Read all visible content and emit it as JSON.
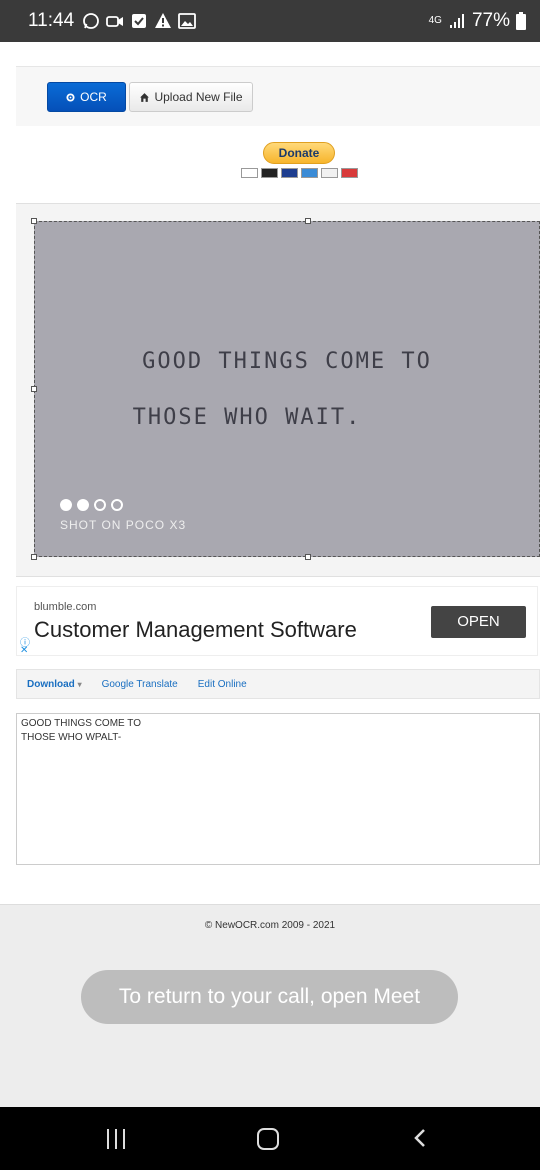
{
  "status_bar": {
    "time": "11:44",
    "network": "4G",
    "battery": "77%",
    "left_icons": [
      "whatsapp-icon",
      "video-call-icon",
      "check-box-icon",
      "warning-icon",
      "image-icon"
    ]
  },
  "toolbar": {
    "ocr_label": "OCR",
    "upload_label": "Upload New File"
  },
  "donate": {
    "label": "Donate",
    "cards": [
      "visa",
      "mastercard",
      "maestro",
      "amex",
      "discover",
      "unionpay"
    ]
  },
  "image": {
    "line1": "GOOD THINGS COME TO",
    "line2": "THOSE WHO WAIT.",
    "watermark": "SHOT ON POCO X3"
  },
  "ad": {
    "domain": "blumble.com",
    "title": "Customer Management Software",
    "open_label": "OPEN"
  },
  "result_tabs": {
    "download": "Download",
    "google_translate": "Google Translate",
    "edit_online": "Edit Online"
  },
  "result_text": "GOOD THINGS COME TO\nTHOSE WHO WPALT-",
  "footer": {
    "copyright": "© NewOCR.com 2009 - 2021",
    "toast": "To return to your call, open Meet"
  },
  "colors": {
    "ocr_button": "#0a6cd6",
    "status_bar": "#3a3a3a",
    "photo_bg": "#a9a8b0",
    "link": "#1a6fc1"
  }
}
